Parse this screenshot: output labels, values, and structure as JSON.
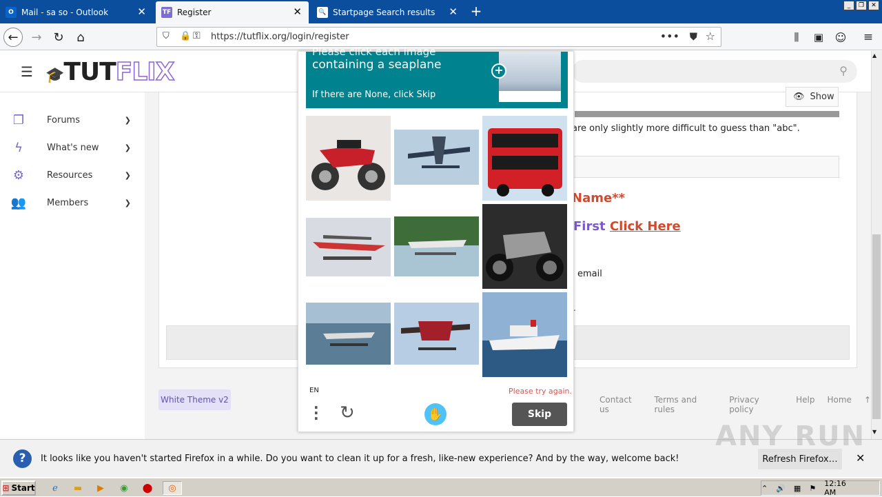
{
  "browser": {
    "tabs": [
      {
        "label": "Mail - sa so - Outlook",
        "icon": "outlook-icon"
      },
      {
        "label": "Register",
        "icon": "tutflix-icon",
        "fav": "TF"
      },
      {
        "label": "Startpage Search results",
        "icon": "startpage-search-icon"
      }
    ],
    "url": "https://tutflix.org/login/register"
  },
  "site": {
    "logo_dark": "TUT",
    "logo_light": "FLIX",
    "nav": [
      {
        "label": "Forums",
        "icon": "forums-icon"
      },
      {
        "label": "What's new",
        "icon": "lightning-icon"
      },
      {
        "label": "Resources",
        "icon": "gears-icon"
      },
      {
        "label": "Members",
        "icon": "members-icon"
      }
    ],
    "show_label": "Show",
    "password_hint": "are only slightly more difficult to guess than \"abc\".",
    "name_text": "Name**",
    "first_text": "First",
    "click_here": "Click Here",
    "email_text": "email",
    "dot_text": "y.",
    "theme_label": "White Theme v2",
    "footer_links": [
      "Contact us",
      "Terms and rules",
      "Privacy policy",
      "Help",
      "Home"
    ]
  },
  "captcha": {
    "title_partial": "Please click each image",
    "title": "containing a seaplane",
    "skip_hint": "If there are None, click Skip",
    "language": "EN",
    "error": "Please try again.",
    "skip_button": "Skip",
    "tiles": [
      "motorbike",
      "seaplane",
      "bus",
      "seaplane",
      "seaplane",
      "motorbike",
      "seaplane",
      "seaplane",
      "cruise-ship"
    ]
  },
  "notification": {
    "text": "It looks like you haven't started Firefox in a while. Do you want to clean it up for a fresh, like-new experience? And by the way, welcome back!",
    "button": "Refresh Firefox…"
  },
  "watermark": "ANY RUN",
  "taskbar": {
    "start": "Start",
    "clock": "12:16 AM"
  }
}
